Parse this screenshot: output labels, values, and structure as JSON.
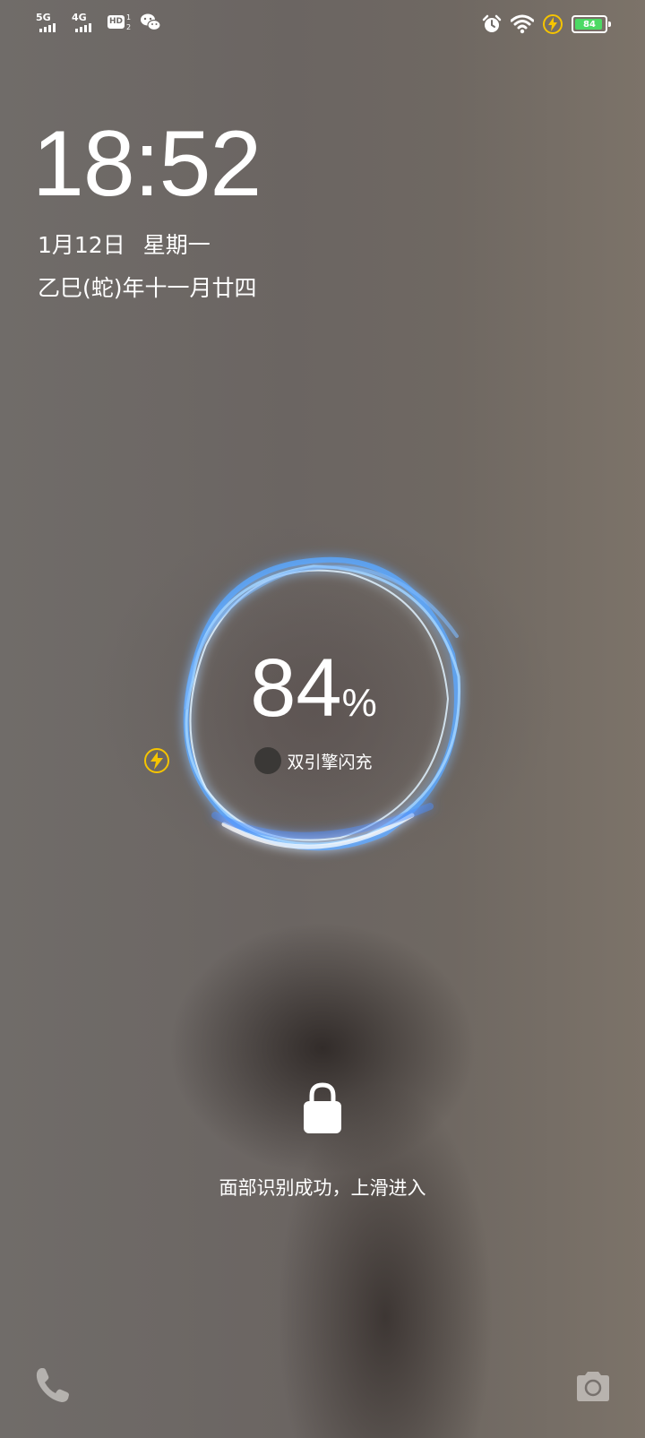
{
  "status_bar": {
    "sim1_network": "5G",
    "sim2_network": "4G",
    "hd_label": "HD",
    "hd_sub_top": "1",
    "hd_sub_bottom": "2",
    "battery_level": "84",
    "icons": [
      "signal-5g-icon",
      "signal-4g-icon",
      "hd-voice-icon",
      "wechat-icon",
      "alarm-icon",
      "wifi-icon",
      "flash-charge-icon",
      "battery-icon"
    ]
  },
  "lockscreen": {
    "time": "18:52",
    "date": "1月12日",
    "weekday": "星期一",
    "lunar_date": "乙巳(蛇)年十一月廿四"
  },
  "charging": {
    "percent": "84",
    "percent_symbol": "%",
    "fast_charge_label": "双引擎闪充",
    "ring_color": "#6fb6ff",
    "bolt_color": "#f5c400"
  },
  "unlock": {
    "hint": "面部识别成功，上滑进入"
  },
  "shortcuts": {
    "left": "phone-icon",
    "right": "camera-icon"
  }
}
